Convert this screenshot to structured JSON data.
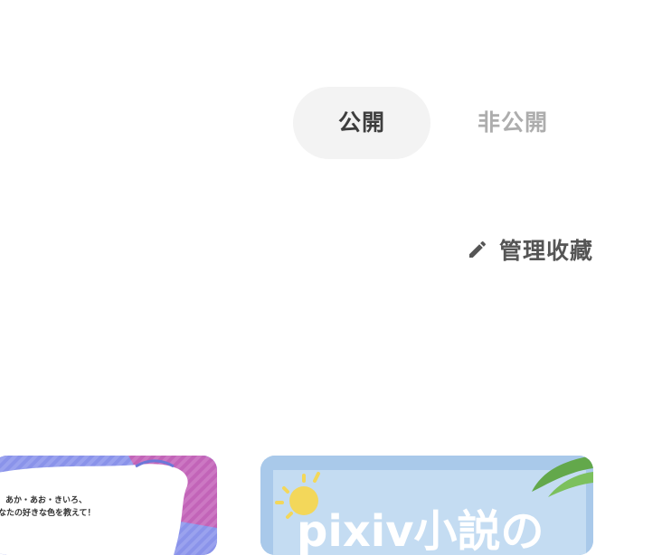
{
  "visibility_tabs": {
    "public_label": "公開",
    "private_label": "非公開"
  },
  "manage": {
    "label": "管理收藏",
    "icon": "pencil-icon"
  },
  "cards": [
    {
      "thumb_lines": [
        "あか・あお・きいろ、",
        "なたの好きな色を教えて！"
      ]
    },
    {
      "thumb_title": "pixiv小説の"
    }
  ],
  "colors": {
    "active_tab_bg": "#f3f3f3",
    "active_tab_text": "#3d3d3d",
    "inactive_tab_text": "#adadad",
    "manage_text": "#555555"
  }
}
